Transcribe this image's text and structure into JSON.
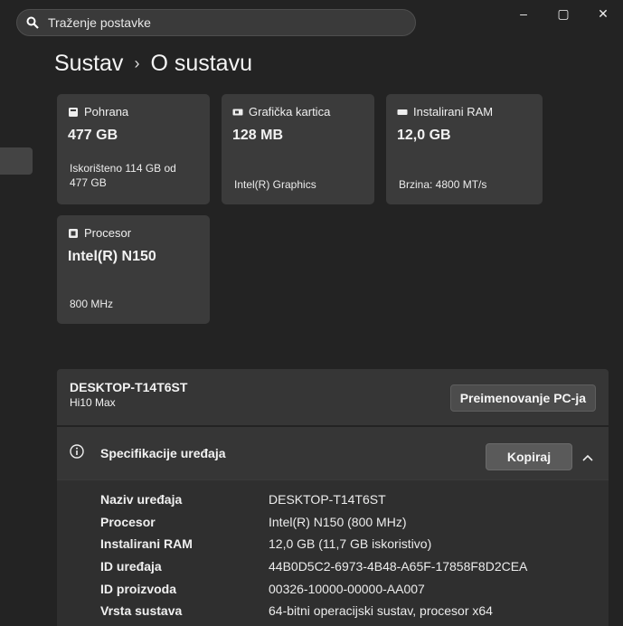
{
  "search": {
    "placeholder": "Traženje postavke",
    "icon": "search-icon"
  },
  "window_controls": {
    "minimize": "–",
    "maximize": "▢",
    "close": "✕"
  },
  "header": {
    "section": "Sustav",
    "page": "O sustavu"
  },
  "cards": {
    "storage": {
      "label": "Pohrana",
      "value": "477 GB",
      "sub1": "Iskorišteno 114 GB od",
      "sub2": "477 GB"
    },
    "gpu": {
      "label": "Grafička kartica",
      "value": "128 MB",
      "sub1": "Intel(R) Graphics"
    },
    "ram": {
      "label": "Instalirani RAM",
      "value": "12,0 GB",
      "sub1": "Brzina: 4800 MT/s"
    },
    "cpu": {
      "label": "Procesor",
      "value": "Intel(R) N150",
      "sub1": "800 MHz"
    }
  },
  "pc": {
    "name": "DESKTOP-T14T6ST",
    "model": "Hi10 Max",
    "rename_label": "Preimenovanje PC-ja"
  },
  "specs": {
    "title": "Specifikacije uređaja",
    "copy_label": "Kopiraj",
    "rows": [
      {
        "k": "Naziv uređaja",
        "v": "DESKTOP-T14T6ST"
      },
      {
        "k": "Procesor",
        "v": "Intel(R) N150 (800 MHz)"
      },
      {
        "k": "Instalirani RAM",
        "v": "12,0 GB (11,7 GB iskoristivo)"
      },
      {
        "k": "ID uređaja",
        "v": "44B0D5C2-6973-4B48-A65F-17858F8D2CEA"
      },
      {
        "k": "ID proizvoda",
        "v": "00326-10000-00000-AA007"
      },
      {
        "k": "Vrsta sustava",
        "v": "64-bitni operacijski sustav, procesor x64"
      }
    ]
  }
}
